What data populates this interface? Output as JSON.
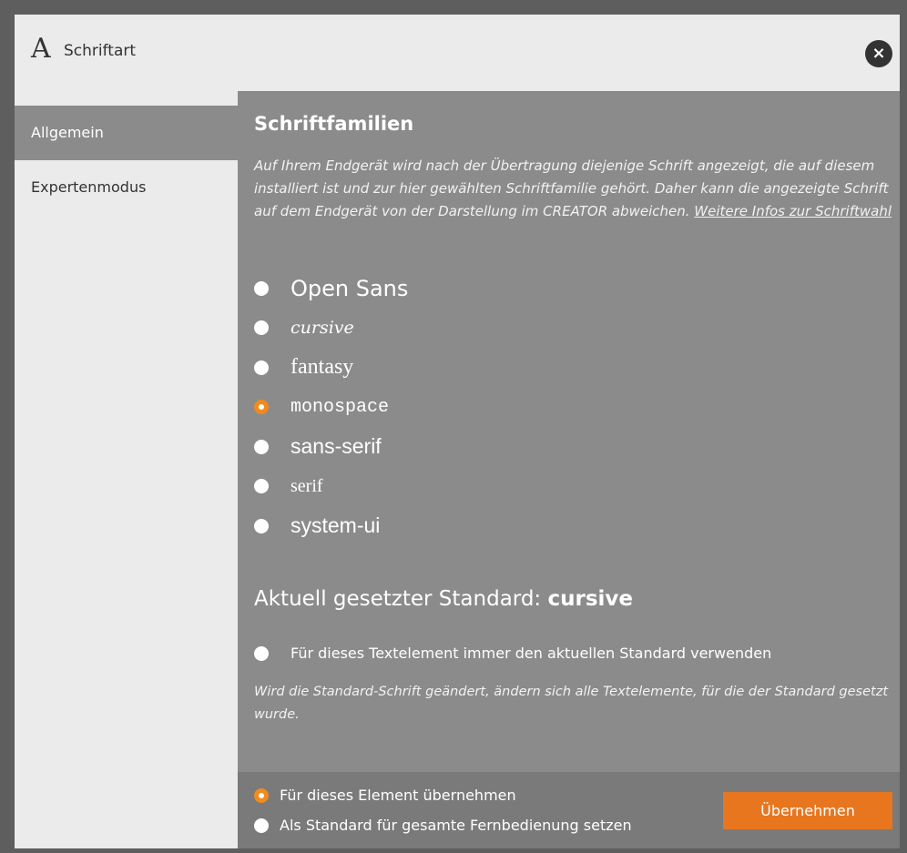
{
  "titlebar": {
    "icon": "A",
    "title": "Schriftart",
    "close_icon": "×"
  },
  "sidebar": {
    "items": [
      {
        "label": "Allgemein",
        "active": true
      },
      {
        "label": "Expertenmodus",
        "active": false
      }
    ]
  },
  "content": {
    "section_title": "Schriftfamilien",
    "description": "Auf Ihrem Endgerät wird nach der Übertragung diejenige Schrift angezeigt, die auf diesem installiert ist und zur hier gewählten Schriftfamilie gehört. Daher kann die angezeigte Schrift auf dem Endgerät von der Darstellung im CREATOR abweichen.",
    "info_link": "Weitere Infos zur Schriftwahl",
    "font_options": [
      {
        "label": "Open Sans",
        "selected": false
      },
      {
        "label": "cursive",
        "selected": false
      },
      {
        "label": "fantasy",
        "selected": false
      },
      {
        "label": "monospace",
        "selected": true
      },
      {
        "label": "sans-serif",
        "selected": false
      },
      {
        "label": "serif",
        "selected": false
      },
      {
        "label": "system-ui",
        "selected": false
      }
    ],
    "standard_prefix": "Aktuell gesetzter Standard:",
    "standard_value": "cursive",
    "use_standard_label": "Für dieses Textelement immer den aktuellen Standard verwenden",
    "note": "Wird die Standard-Schrift geändert, ändern sich alle Textelemente, für die der Standard gesetzt wurde."
  },
  "footer": {
    "options": [
      {
        "label": "Für dieses Element übernehmen",
        "selected": true
      },
      {
        "label": "Als Standard für gesamte Fernbedienung setzen",
        "selected": false
      }
    ],
    "apply_label": "Übernehmen"
  },
  "colors": {
    "accent": "#f28b1e",
    "button": "#e8761e",
    "panel": "#8b8b8b"
  }
}
